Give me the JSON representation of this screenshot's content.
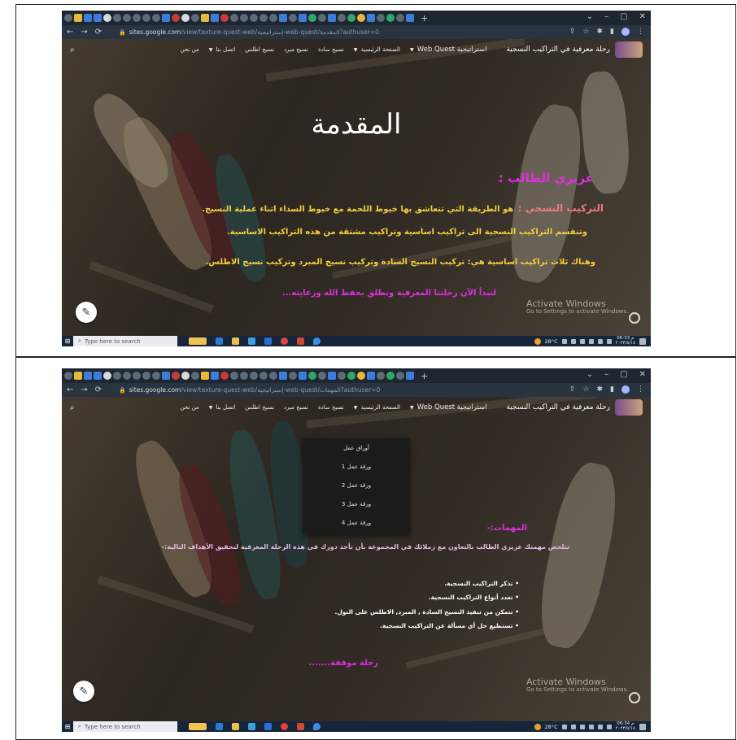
{
  "browser": {
    "url_host": "sites.google.com",
    "shot1_url_path": "/view/texture-quest-web/إستراتيجية-web-quest/المقدمة?authuser=0",
    "shot2_url_path": "/view/texture-quest-web/إستراتيجية-web-quest/المهمات?authuser=0",
    "new_tab_symbol": "+",
    "window_controls": [
      "⌄",
      "–",
      "▢",
      "✕"
    ]
  },
  "site": {
    "title": "رحلة معرفية في التراكيب النسجية",
    "nav": {
      "webquest": "استراتيجية Web Quest",
      "home": "الصفحة الرئيسية",
      "weave_plain": "نسيج سادة",
      "weave_twill": "نسيج مبرد",
      "weave_satin": "نسيج اطلس",
      "contact": "اتصل بنا",
      "about": "من نحن"
    }
  },
  "shot1": {
    "heading": "المقدمة",
    "greeting": "عزيزي الطالب :",
    "term": "التركيب النسجي :",
    "definition": "هو الطريقة التي تتعاشق بها خيوط اللحمة مع خيوط السداء اثناء عملية النسيج.",
    "division": "وتنقسم التراكيب النسجية الى تراكيب اساسية وتراكيب مشتقة من هذه التراكيب الاساسية.",
    "three_types": "وهناك ثلاث تراكيب اساسية هي: تركيب النسيج السادة وتركيب نسيج المبرد وتركيب نسيج الاطلس.",
    "start": "لنبدأ الآن رحلتنا المعرفية ونطلق بحفظ الله ورعايته..."
  },
  "shot2": {
    "dropdown": {
      "header": "أوراق عمل",
      "items": [
        "ورقة عمل 1",
        "ورقة عمل 2",
        "ورقة عمل 3",
        "ورقة عمل 4"
      ]
    },
    "tasks_title": "المهمات:-",
    "tasks_intro": "تتلخص مهمتك عزيزي الطالب بالتعاون مع زملائك في المجموعة بأن تأخذ دورك في هذه الرحلة المعرفية لتحقيق الأهداف التالية:-",
    "tasks": [
      "تذكر التراكيب النسجية.",
      "تعدد أنواع التراكيب النسجية.",
      "تتمكن من تنفيذ النسيج السادة , المبرد, الاطلس على النول.",
      "تستطيع حل أي مسألة عن التراكيب النسجية."
    ],
    "closing": "رحلة موفقة......."
  },
  "watermark": {
    "title": "Activate Windows",
    "subtitle": "Go to Settings to activate Windows."
  },
  "taskbar": {
    "search_placeholder": "Type here to search",
    "weather": "28°C",
    "clock_time_1": "06:33 م",
    "clock_time_2": "06:34 م",
    "clock_date": "٢٠٢٣/٥/١٨"
  },
  "colors": {
    "magenta": "#e02ee0",
    "gold": "#f2cf3c",
    "taskbar": "#16253a",
    "tabstrip": "#1e2630"
  }
}
